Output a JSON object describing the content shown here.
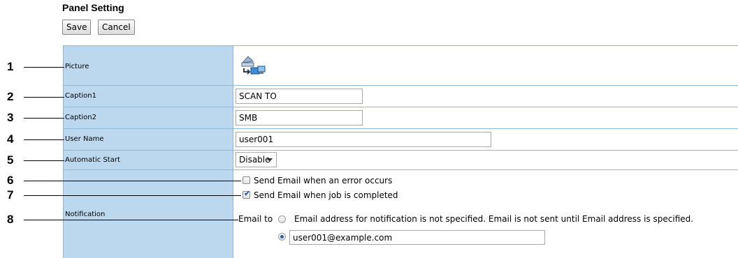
{
  "header": {
    "title": "Panel Setting",
    "save_label": "Save",
    "cancel_label": "Cancel"
  },
  "callouts": [
    "1",
    "2",
    "3",
    "4",
    "5",
    "6",
    "7",
    "8"
  ],
  "rows": {
    "picture": {
      "label": "Picture",
      "icon": "scan-to-folder-icon"
    },
    "caption1": {
      "label": "Caption1",
      "value": "SCAN TO"
    },
    "caption2": {
      "label": "Caption2",
      "value": "SMB"
    },
    "user_name": {
      "label": "User Name",
      "value": "user001"
    },
    "automatic_start": {
      "label": "Automatic Start",
      "selected": "Disable"
    },
    "notification": {
      "label": "Notification",
      "error_option": {
        "label": "Send Email when an error occurs",
        "checked": false
      },
      "complete_option": {
        "label": "Send Email when job is completed",
        "checked": true
      },
      "email_to_label": "Email to",
      "unspecified_option": {
        "label": "Email address for notification is not specified. Email is not sent until Email address is specified.",
        "selected": false
      },
      "email_value": "user001@example.com"
    }
  },
  "colors": {
    "label_bg": "#bcd8ee",
    "grid": "#8fb7d6",
    "check": "#2e63b5"
  }
}
